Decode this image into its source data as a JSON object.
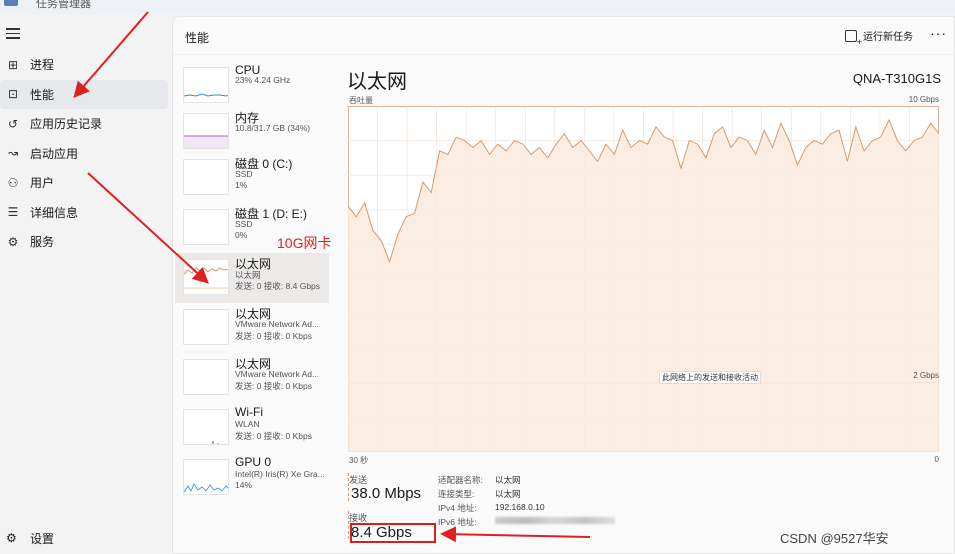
{
  "app": {
    "title": "任务管理器"
  },
  "nav": {
    "items": [
      {
        "label": "进程",
        "icon": "processes-icon"
      },
      {
        "label": "性能",
        "icon": "performance-icon",
        "active": true
      },
      {
        "label": "应用历史记录",
        "icon": "history-icon"
      },
      {
        "label": "启动应用",
        "icon": "startup-icon"
      },
      {
        "label": "用户",
        "icon": "users-icon"
      },
      {
        "label": "详细信息",
        "icon": "details-icon"
      },
      {
        "label": "服务",
        "icon": "services-icon"
      }
    ],
    "settings_label": "设置"
  },
  "header": {
    "title": "性能",
    "run_task_label": "运行新任务",
    "more_label": "···"
  },
  "devices": [
    {
      "name": "CPU",
      "line1": "23% 4.24 GHz"
    },
    {
      "name": "内存",
      "line1": "10.8/31.7 GB (34%)"
    },
    {
      "name": "磁盘 0 (C:)",
      "line1": "SSD",
      "line2": "1%"
    },
    {
      "name": "磁盘 1 (D: E:)",
      "line1": "SSD",
      "line2": "0%"
    },
    {
      "name": "以太网",
      "line1": "以太网",
      "line2": "发送: 0 接收: 8.4 Gbps",
      "selected": true
    },
    {
      "name": "以太网",
      "line1": "VMware Network Ad...",
      "line2": "发送: 0 接收: 0 Kbps"
    },
    {
      "name": "以太网",
      "line1": "VMware Network Ad...",
      "line2": "发送: 0 接收: 0 Kbps"
    },
    {
      "name": "Wi-Fi",
      "line1": "WLAN",
      "line2": "发送: 0 接收: 0 Kbps"
    },
    {
      "name": "GPU 0",
      "line1": "Intel(R) Iris(R) Xe Gra...",
      "line2": "14%"
    }
  ],
  "annotation": "10G网卡",
  "detail": {
    "title": "以太网",
    "device": "QNA-T310G1S",
    "throughput_label": "吞吐量",
    "max_label": "10 Gbps",
    "mid_label": "此网络上的发送和接收活动",
    "mid_scale": "2 Gbps",
    "time_start": "30 秒",
    "time_end": "0",
    "send_label": "发送",
    "send_value": "38.0 Mbps",
    "recv_label": "接收",
    "recv_value": "8.4 Gbps",
    "props": [
      {
        "key": "适配器名称:",
        "value": "以太网"
      },
      {
        "key": "连接类型:",
        "value": "以太网"
      },
      {
        "key": "IPv4 地址:",
        "value": "192.168.0.10"
      },
      {
        "key": "IPv6 地址:",
        "value": ""
      }
    ]
  },
  "chart_data": {
    "type": "area",
    "ylim": [
      0,
      10
    ],
    "values": [
      7.1,
      6.8,
      7.2,
      6.4,
      6.1,
      5.5,
      6.3,
      6.8,
      6.9,
      7.8,
      7.5,
      8.7,
      8.6,
      9.1,
      9.0,
      8.8,
      9.0,
      8.6,
      8.9,
      8.7,
      9.0,
      8.9,
      8.6,
      8.8,
      8.5,
      8.9,
      9.2,
      8.8,
      9.0,
      8.7,
      8.4,
      8.9,
      8.6,
      9.3,
      8.8,
      9.0,
      8.9,
      9.4,
      9.1,
      9.0,
      8.2,
      9.0,
      8.9,
      8.5,
      9.2,
      9.4,
      8.8,
      9.1,
      9.0,
      8.6,
      9.3,
      8.8,
      9.5,
      9.0,
      8.3,
      8.8,
      9.0,
      8.9,
      9.2,
      9.3,
      8.4,
      9.4,
      8.7,
      9.0,
      9.1,
      9.6,
      9.0,
      8.7,
      9.0,
      9.1,
      9.5,
      9.2
    ],
    "colors": {
      "line": "#d89a6c",
      "fill": "#fbeadd",
      "grid": "#ecdfd5",
      "border": "#d8b49a"
    }
  },
  "watermark": "CSDN @9527华安"
}
